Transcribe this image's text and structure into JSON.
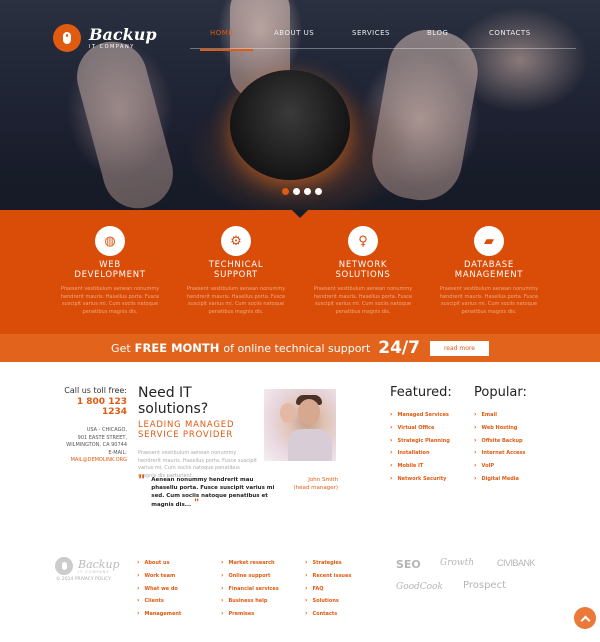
{
  "brand": {
    "name": "Backup",
    "tagline": "IT COMPANY",
    "accent": "#e05a10"
  },
  "nav": {
    "items": [
      {
        "label": "HOME",
        "active": true
      },
      {
        "label": "ABOUT US",
        "active": false
      },
      {
        "label": "SERVICES",
        "active": false
      },
      {
        "label": "BLOG",
        "active": false
      },
      {
        "label": "CONTACTS",
        "active": false
      }
    ]
  },
  "slider": {
    "total_slides": 4,
    "active_slide": 1
  },
  "services": [
    {
      "icon": "globe-icon",
      "title_l1": "WEB",
      "title_l2": "DEVELOPMENT",
      "text": "Praesent vestibulum aenean nonummy hendrerit mauris. Hasellus porta. Fusce suscipit varius mi. Cum sociis natoque penatibus magnis dis."
    },
    {
      "icon": "gears-icon",
      "title_l1": "TECHNICAL",
      "title_l2": "SUPPORT",
      "text": "Praesent vestibulum aenean nonummy hendrerit mauris. Hasellus porta. Fusce suscipit varius mi. Cum sociis natoque penatibus magnis dis."
    },
    {
      "icon": "lightbulb-icon",
      "title_l1": "NETWORK",
      "title_l2": "SOLUTIONS",
      "text": "Praesent vestibulum aenean nonummy hendrerit mauris. Hasellus porta. Fusce suscipit varius mi. Cum sociis natoque penatibus magnis dis."
    },
    {
      "icon": "folder-icon",
      "title_l1": "DATABASE",
      "title_l2": "MANAGEMENT",
      "text": "Praesent vestibulum aenean nonummy hendrerit mauris. Hasellus porta. Fusce suscipit varius mi. Cum sociis natoque penatibus magnis dis."
    }
  ],
  "banner": {
    "prefix": "Get",
    "highlight": "FREE MONTH",
    "middle": "of online technical support",
    "big": "24/7",
    "button": "read more"
  },
  "contact": {
    "call_label": "Call us toll free:",
    "phone": "1 800 123 1234",
    "address_l1": "USA - CHICAGO,",
    "address_l2": "901 EASTE STREET,",
    "address_l3": "WILMINGTON, CA 90744",
    "email_label": "E-MAIL:",
    "email": "MAIL@DEMOLINK.ORG"
  },
  "about": {
    "heading": "Need IT solutions?",
    "subheading_l1": "LEADING MANAGED",
    "subheading_l2": "SERVICE PROVIDER",
    "text": "Praesent vestibulum aenean nonummy hendrerit mauris. Hasellus porta. Fusce suscipit varius mi. Cum sociis natoque penatibus magnis dis parturient.",
    "quote": "Aenean nonummy hendrerit mau phasellu porta. Fusce suscipit varius mi sed. Cum sociis natoque penatibus et magnis dis...",
    "author_name": "John Smith",
    "author_role": "(head manager)"
  },
  "featured": {
    "title": "Featured:",
    "items": [
      "Managed Services",
      "Virtual Office",
      "Strategic Planning",
      "Installation",
      "Mobile IT",
      "Network Security"
    ]
  },
  "popular": {
    "title": "Popular:",
    "items": [
      "Email",
      "Web Hosting",
      "Offsite Backup",
      "Internet Access",
      "VoIP",
      "Digital Media"
    ]
  },
  "footer": {
    "logo_name": "Backup",
    "logo_tagline": "IT COMPANY",
    "copyright": "© 2014 PRIVACY POLICY",
    "col1": [
      "About us",
      "Work team",
      "What we do",
      "Clients",
      "Management"
    ],
    "col2": [
      "Market research",
      "Online support",
      "Financial services",
      "Business help",
      "Premises"
    ],
    "col3": [
      "Strategies",
      "Recent issues",
      "FAQ",
      "Solutions",
      "Contacts"
    ],
    "partners": [
      "SEO",
      "Growth",
      "CIVIBANK",
      "GoodCook",
      "Prospect"
    ]
  }
}
